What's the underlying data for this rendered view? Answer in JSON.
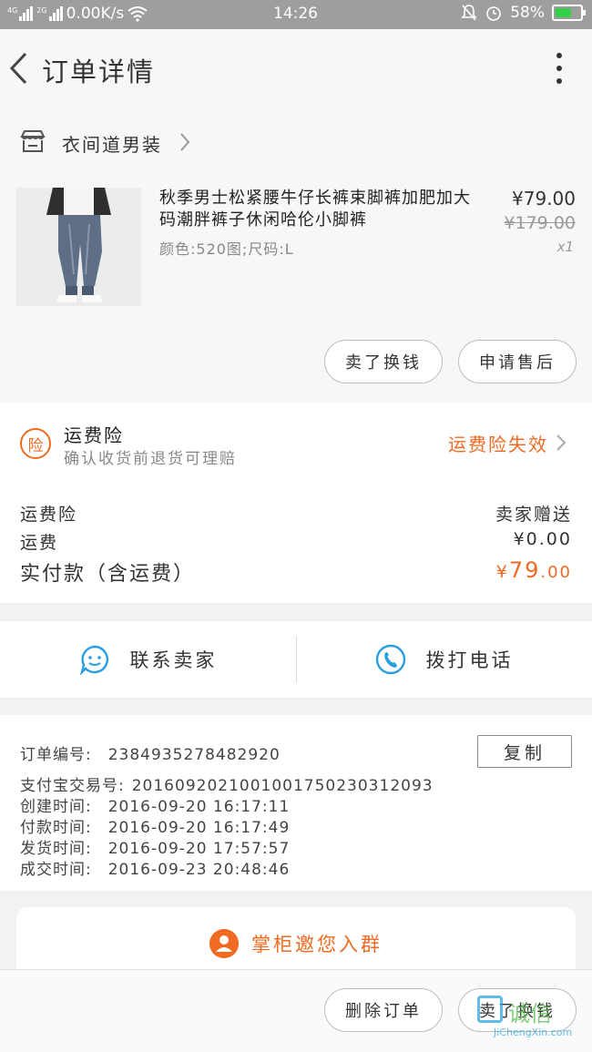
{
  "status_bar": {
    "network1": "4G",
    "network2": "2G",
    "speed": "0.00K/s",
    "time": "14:26",
    "battery": "58%",
    "battery_level": 0.58
  },
  "header": {
    "title": "订单详情"
  },
  "shop": {
    "name": "衣间道男装"
  },
  "product": {
    "name": "秋季男士松紧腰牛仔长裤束脚裤加肥加大码潮胖裤子休闲哈伦小脚裤",
    "spec": "颜色:520图;尺码:L",
    "price": "¥79.00",
    "original_price": "¥179.00",
    "quantity": "x1",
    "refund_button": "卖了换钱",
    "aftersale_button": "申请售后"
  },
  "insurance": {
    "badge": "险",
    "title": "运费险",
    "subtitle": "确认收货前退货可理赔",
    "status": "运费险失效"
  },
  "fees": {
    "rows": [
      {
        "label": "运费险",
        "value": "卖家赠送"
      },
      {
        "label": "运费",
        "value": "¥0.00"
      }
    ],
    "total_label": "实付款（含运费）",
    "total_currency": "¥",
    "total_int": "79",
    "total_dec": ".00"
  },
  "contact": {
    "seller": "联系卖家",
    "phone": "拨打电话"
  },
  "order": {
    "number_label": "订单编号:",
    "number": "2384935278482920",
    "copy_button": "复制",
    "alipay_label": "支付宝交易号:",
    "alipay": "2016092021001001750230312093",
    "created_label": "创建时间:",
    "created": "2016-09-20 16:17:11",
    "paid_label": "付款时间:",
    "paid": "2016-09-20 16:17:49",
    "shipped_label": "发货时间:",
    "shipped": "2016-09-20 17:57:57",
    "completed_label": "成交时间:",
    "completed": "2016-09-23 20:48:46"
  },
  "invite": {
    "label": "掌柜邀您入群"
  },
  "bottom": {
    "delete_button": "删除订单",
    "refund_button": "卖了换钱"
  },
  "watermark": {
    "brand": "诚信",
    "url": "JiChengXin.com"
  },
  "colors": {
    "accent": "#f06a22",
    "contact_blue": "#2a9fe0"
  }
}
